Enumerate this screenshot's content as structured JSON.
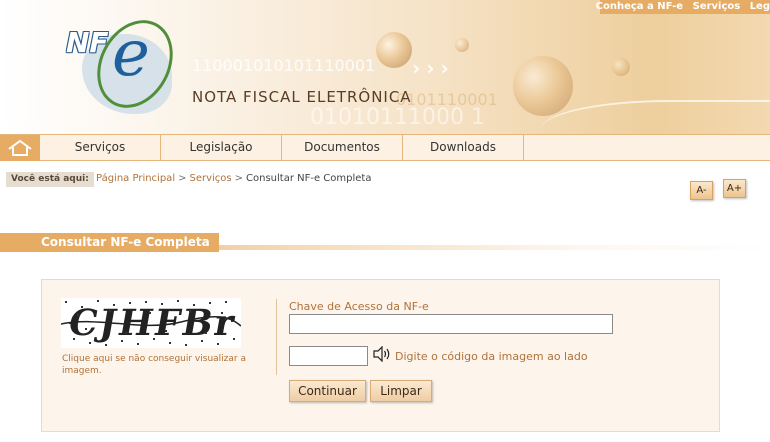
{
  "header": {
    "top_links": [
      "Conheça a NF-e",
      "Serviços",
      "Leg"
    ],
    "logo_text_nf": "NF",
    "logo_text_e": "e",
    "title": "NOTA FISCAL ELETRÔNICA",
    "binary_1": "110001010101110001",
    "binary_2": "0101110001",
    "binary_3": "01010111000 1"
  },
  "nav": {
    "items": [
      "Serviços",
      "Legislação",
      "Documentos",
      "Downloads"
    ]
  },
  "breadcrumb": {
    "label": "Você está aqui:",
    "items": [
      "Página Principal",
      "Serviços",
      "Consultar NF-e Completa"
    ]
  },
  "font_controls": {
    "decrease": "A-",
    "increase": "A+"
  },
  "section": {
    "title": "Consultar NF-e Completa"
  },
  "form": {
    "captcha_text": "CJHFBr",
    "captcha_help": "Clique aqui se não conseguir visualizar a imagem.",
    "access_key_label": "Chave de Acesso da NF-e",
    "access_key_value": "",
    "code_value": "",
    "code_label": "Digite o código da imagem ao lado",
    "submit_label": "Continuar",
    "clear_label": "Limpar"
  },
  "colors": {
    "accent": "#e7ac64",
    "link": "#b0723a",
    "panel": "#fdf5eb"
  }
}
